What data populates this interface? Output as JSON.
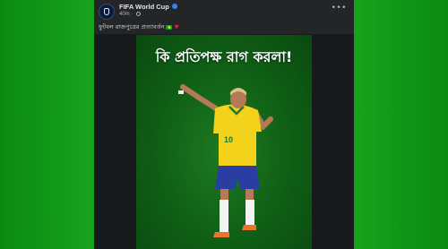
{
  "post": {
    "page_name": "FIFA World Cup",
    "timestamp": "40m",
    "caption": "ফুটবল রাজপুত্রের প্রত্যাবর্তন",
    "headline": "কি প্রতিপক্ষ রাগ করলা!",
    "jersey_number": "10"
  },
  "icons": {
    "avatar": "fifa-world-cup-logo",
    "verified": "verified-badge-icon",
    "privacy": "globe-icon",
    "more": "more-options-icon",
    "flag": "brazil-flag-icon",
    "heart": "heart-icon"
  },
  "colors": {
    "background_green": "#159a1b",
    "post_background": "#18191a",
    "header_background": "#242526",
    "verified_blue": "#2d88ff",
    "jersey_yellow": "#f2d21b",
    "shorts_blue": "#2a3da0"
  }
}
